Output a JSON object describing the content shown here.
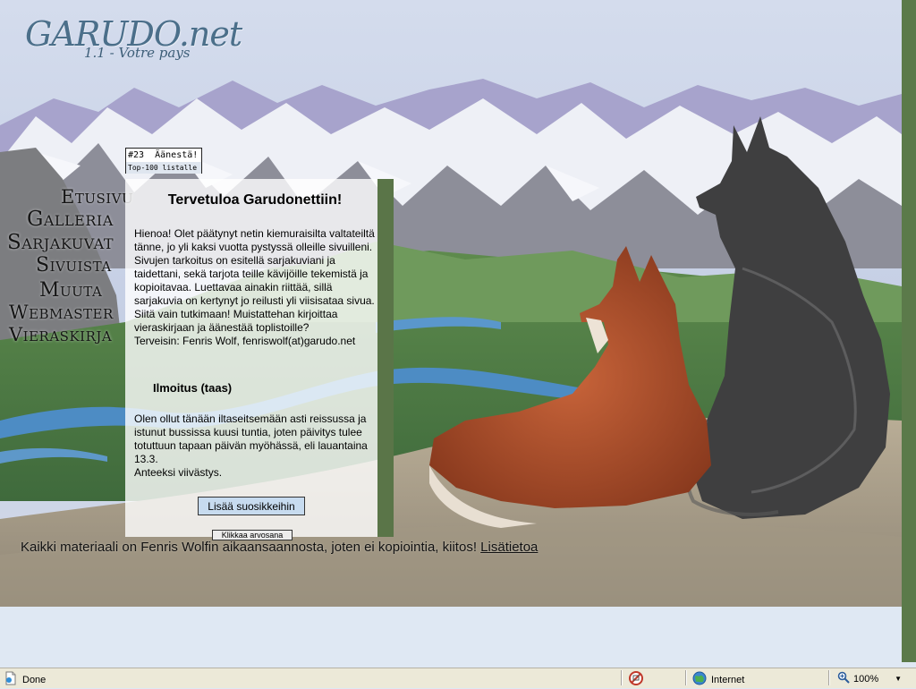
{
  "logo": {
    "name": "GARUDO.net",
    "version_text": "1.1 - Votre pays"
  },
  "nav": [
    {
      "id": "etusivu",
      "label": "Etusivu"
    },
    {
      "id": "galleria",
      "label": "Galleria"
    },
    {
      "id": "sarjakuvat",
      "label": "Sarjakuvat"
    },
    {
      "id": "sivuista",
      "label": "Sivuista"
    },
    {
      "id": "muuta",
      "label": "Muuta"
    },
    {
      "id": "webmaster",
      "label": "Webmaster"
    },
    {
      "id": "vieraskirja",
      "label": "Vieraskirja"
    }
  ],
  "toplist_badge": {
    "rank": "#23",
    "vote_label": "Äänestä!",
    "caption": "Top-100 listalle"
  },
  "welcome": {
    "title": "Tervetuloa Garudonettiin!",
    "body": "Hienoa! Olet päätynyt netin kiemuraisilta valtateiltä tänne, jo yli kaksi vuotta pystyssä olleille sivuilleni. Sivujen tarkoitus on esitellä sarjakuviani ja taidettani, sekä tarjota teille kävijöille tekemistä ja kopioitavaa. Luettavaa ainakin riittää, sillä sarjakuvia on kertynyt jo reilusti yli viisisataa sivua. Siitä vain tutkimaan! Muistattehan kirjoittaa vieraskirjaan ja äänestää toplistoille?",
    "signature": "Terveisin: Fenris Wolf, fenriswolf(at)garudo.net"
  },
  "announcement": {
    "title": "Ilmoitus (taas)",
    "body": "Olen ollut tänään iltaseitsemään asti reissussa ja istunut bussissa kuusi tuntia, joten päivitys tulee totuttuun tapaan päivän myöhässä, eli lauantaina 13.3.",
    "apology": "Anteeksi viivästys."
  },
  "buttons": {
    "favorite": "Lisää suosikkeihin",
    "rate": "Klikkaa arvosana"
  },
  "footer": {
    "text": "Kaikki materiaali on Fenris Wolfin aikaansaannosta, joten ei kopiointia, kiitos!",
    "link_text": "Lisätietoa"
  },
  "statusbar": {
    "status": "Done",
    "zone": "Internet",
    "zoom": "100%"
  },
  "colors": {
    "panel_border": "#5a7548",
    "scrollbar": "#5b7a4a",
    "button_bg": "#c7dbef",
    "statusbar_bg": "#ece9d8"
  },
  "icons": [
    "page-done-icon",
    "popup-blocker-icon",
    "internet-globe-icon",
    "zoom-icon",
    "dropdown-arrow-icon"
  ]
}
